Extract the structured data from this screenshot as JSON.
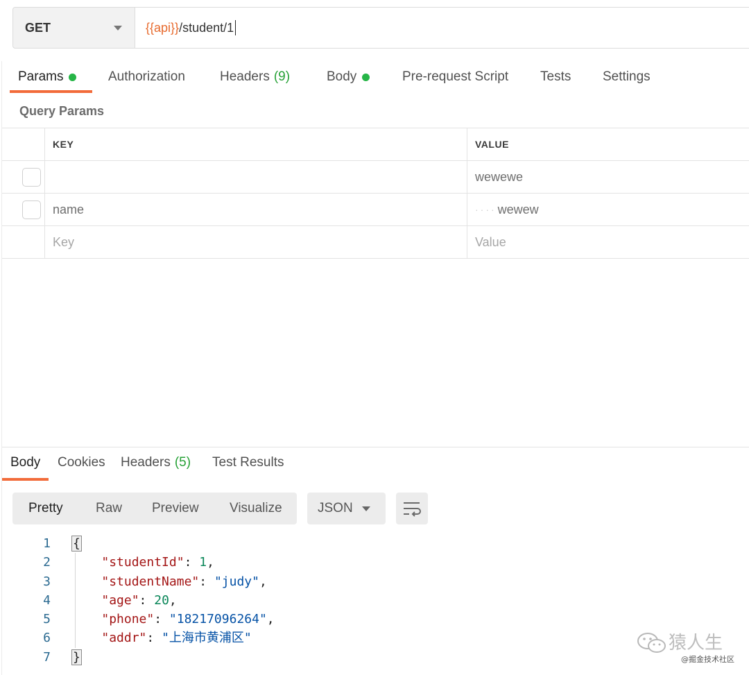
{
  "request": {
    "method": "GET",
    "url_variable": "{{api}}",
    "url_path": "/student/1"
  },
  "request_tabs": [
    {
      "label": "Params",
      "indicator": "dot",
      "active": true
    },
    {
      "label": "Authorization"
    },
    {
      "label": "Headers",
      "count": "(9)"
    },
    {
      "label": "Body",
      "indicator": "dot"
    },
    {
      "label": "Pre-request Script"
    },
    {
      "label": "Tests"
    },
    {
      "label": "Settings"
    }
  ],
  "query_params": {
    "section_title": "Query Params",
    "columns": {
      "key": "KEY",
      "value": "VALUE"
    },
    "rows": [
      {
        "key": "",
        "value": "wewewe"
      },
      {
        "key": "name",
        "value": "wewew",
        "value_prefix": "····"
      }
    ],
    "new_row": {
      "key_placeholder": "Key",
      "value_placeholder": "Value"
    }
  },
  "response_tabs": [
    {
      "label": "Body",
      "active": true
    },
    {
      "label": "Cookies"
    },
    {
      "label": "Headers",
      "count": "(5)"
    },
    {
      "label": "Test Results"
    }
  ],
  "response_view": {
    "options": [
      "Pretty",
      "Raw",
      "Preview",
      "Visualize"
    ],
    "selected": "Pretty",
    "format": "JSON",
    "wrap_icon": "wrap-lines-icon"
  },
  "response_body": {
    "line_numbers": [
      "1",
      "2",
      "3",
      "4",
      "5",
      "6",
      "7"
    ],
    "open_brace": "{",
    "close_brace": "}",
    "fields": [
      {
        "key": "\"studentId\"",
        "value": "1",
        "type": "number"
      },
      {
        "key": "\"studentName\"",
        "value": "\"judy\"",
        "type": "string"
      },
      {
        "key": "\"age\"",
        "value": "20",
        "type": "number"
      },
      {
        "key": "\"phone\"",
        "value": "\"18217096264\"",
        "type": "string"
      },
      {
        "key": "\"addr\"",
        "value": "\"上海市黄浦区\"",
        "type": "string"
      }
    ]
  },
  "watermark": {
    "title": "猿人生",
    "subtitle": "@掘金技术社区",
    "icon": "wechat-icon"
  },
  "colors": {
    "accent": "#f26b3a",
    "url_variable": "#e7692c",
    "indicator_green": "#26b547",
    "count_green": "#26a136",
    "json_key": "#a31515",
    "json_number": "#098658",
    "json_string": "#0451a5",
    "line_number": "#2b6a91"
  }
}
